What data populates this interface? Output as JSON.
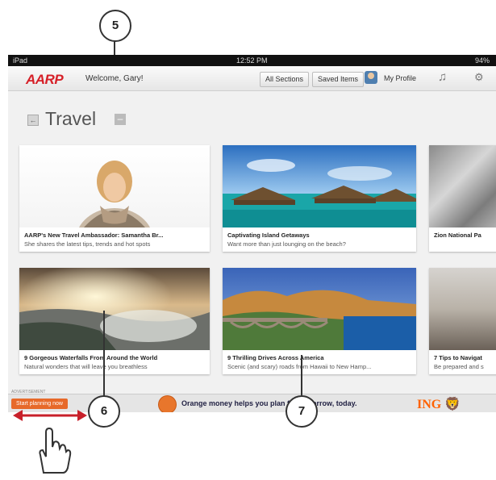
{
  "status": {
    "device": "iPad",
    "time": "12:52 PM",
    "battery": "94%"
  },
  "header": {
    "logo": "AARP",
    "welcome": "Welcome, Gary!",
    "all_sections": "All Sections",
    "saved_items": "Saved Items",
    "profile": "My Profile",
    "icons": [
      "music-icon",
      "gear-icon"
    ]
  },
  "section": {
    "title": "Travel",
    "back": "←",
    "minus": "–"
  },
  "cards": [
    {
      "title": "AARP's New Travel Ambassador: Samantha Br...",
      "subtitle": "She shares the latest tips, trends and hot spots"
    },
    {
      "title": "Captivating Island Getaways",
      "subtitle": "Want more than just lounging on the beach?"
    },
    {
      "title": "Zion National Pa",
      "subtitle": ""
    },
    {
      "title": "9 Gorgeous Waterfalls From Around the World",
      "subtitle": "Natural wonders that will leave you breathless"
    },
    {
      "title": "9 Thrilling Drives Across America",
      "subtitle": "Scenic (and scary) roads from Hawaii to New Hamp..."
    },
    {
      "title": "7 Tips to Navigat",
      "subtitle": "Be prepared and s"
    }
  ],
  "ad": {
    "tag": "ADVERTISEMENT",
    "button": "Start planning now",
    "text": "Orange money helps you plan for tomorrow, today.",
    "brand": "ING"
  },
  "callouts": [
    "5",
    "6",
    "7"
  ],
  "colors": {
    "aarp_red": "#d62028",
    "ing_orange": "#ff6200"
  }
}
